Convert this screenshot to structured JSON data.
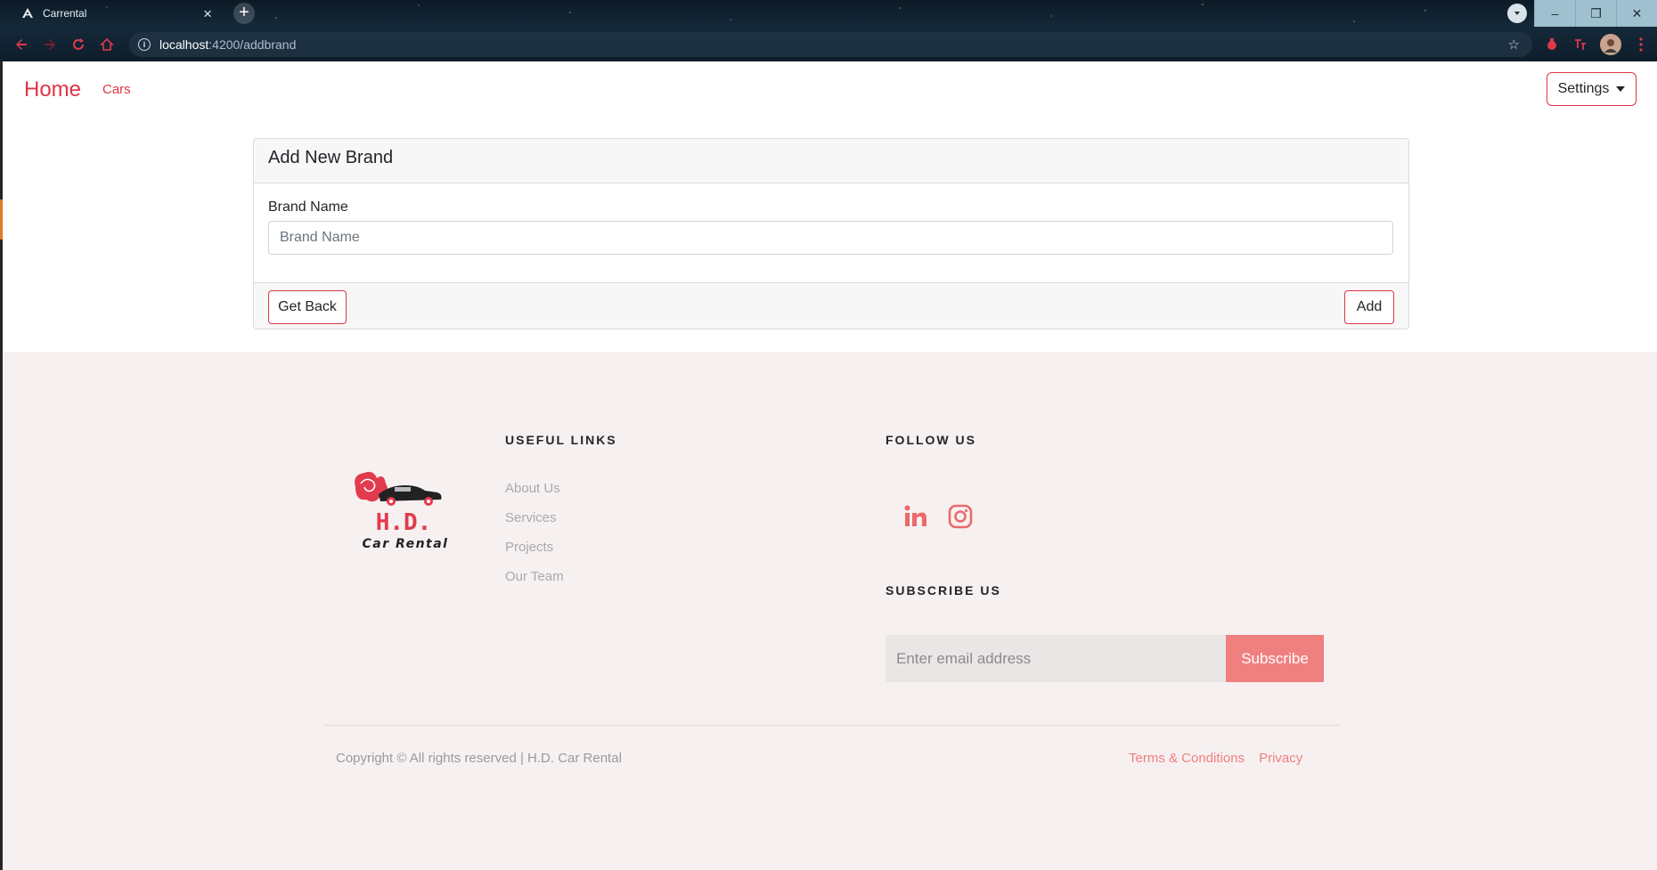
{
  "browser": {
    "tab_title": "Carrental",
    "tab_close": "×",
    "new_tab": "+",
    "url_host": "localhost",
    "url_path": ":4200/addbrand",
    "window_controls": {
      "minimize": "–",
      "restore": "❐",
      "close": "✕"
    }
  },
  "navbar": {
    "home_label": "Home",
    "cars_label": "Cars",
    "settings_label": "Settings"
  },
  "form": {
    "title": "Add New Brand",
    "brand_name_label": "Brand Name",
    "brand_name_placeholder": "Brand Name",
    "brand_name_value": "",
    "back_button": "Get Back",
    "add_button": "Add"
  },
  "footer": {
    "logo_text_main": "H.D.",
    "logo_text_sub": "Car Rental",
    "useful_links_heading": "USEFUL LINKS",
    "useful_links": [
      {
        "label": "About Us"
      },
      {
        "label": "Services"
      },
      {
        "label": "Projects"
      },
      {
        "label": "Our Team"
      }
    ],
    "follow_heading": "FOLLOW US",
    "social_icons": [
      "linkedin-icon",
      "instagram-icon"
    ],
    "subscribe_heading": "SUBSCRIBE US",
    "email_placeholder": "Enter email address",
    "subscribe_button": "Subscribe",
    "copyright": "Copyright © All rights reserved | H.D. Car Rental",
    "terms_label": "Terms & Conditions",
    "privacy_label": "Privacy"
  },
  "colors": {
    "accent_red": "#dc3545",
    "footer_accent": "#f08080",
    "footer_bg": "#f7f0f0"
  }
}
